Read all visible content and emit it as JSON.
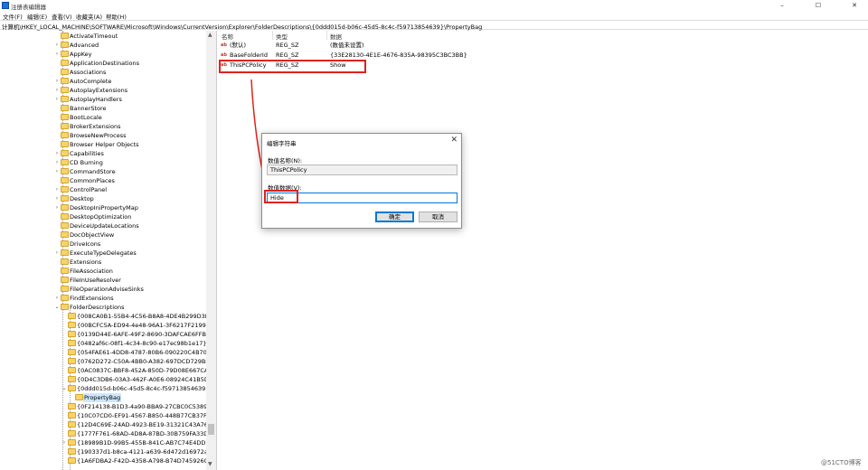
{
  "window": {
    "title": "注册表编辑器",
    "min": "–",
    "max": "☐",
    "close": "✕"
  },
  "menu": [
    "文件(F)",
    "编辑(E)",
    "查看(V)",
    "收藏夹(A)",
    "帮助(H)"
  ],
  "address": "计算机\\HKEY_LOCAL_MACHINE\\SOFTWARE\\Microsoft\\Windows\\CurrentVersion\\Explorer\\FolderDescriptions\\{0ddd015d-b06c-45d5-8c4c-f59713854639}\\PropertyBag",
  "tree": [
    {
      "label": "ActivateTimeout",
      "exp": ""
    },
    {
      "label": "Advanced",
      "exp": "›"
    },
    {
      "label": "AppKey",
      "exp": "›"
    },
    {
      "label": "ApplicationDestinations",
      "exp": ""
    },
    {
      "label": "Associations",
      "exp": ""
    },
    {
      "label": "AutoComplete",
      "exp": "›"
    },
    {
      "label": "AutoplayExtensions",
      "exp": "›"
    },
    {
      "label": "AutoplayHandlers",
      "exp": "›"
    },
    {
      "label": "BannerStore",
      "exp": ""
    },
    {
      "label": "BootLocale",
      "exp": ""
    },
    {
      "label": "BrokerExtensions",
      "exp": ""
    },
    {
      "label": "BrowseNewProcess",
      "exp": ""
    },
    {
      "label": "Browser Helper Objects",
      "exp": ""
    },
    {
      "label": "Capabilities",
      "exp": "›"
    },
    {
      "label": "CD Burning",
      "exp": "›"
    },
    {
      "label": "CommandStore",
      "exp": "›"
    },
    {
      "label": "CommonPlaces",
      "exp": ""
    },
    {
      "label": "ControlPanel",
      "exp": "›"
    },
    {
      "label": "Desktop",
      "exp": "›"
    },
    {
      "label": "DesktopIniPropertyMap",
      "exp": "›"
    },
    {
      "label": "DesktopOptimization",
      "exp": ""
    },
    {
      "label": "DeviceUpdateLocations",
      "exp": ""
    },
    {
      "label": "DocObjectView",
      "exp": ""
    },
    {
      "label": "DriveIcons",
      "exp": ""
    },
    {
      "label": "ExecuteTypeDelegates",
      "exp": "›"
    },
    {
      "label": "Extensions",
      "exp": ""
    },
    {
      "label": "FileAssociation",
      "exp": ""
    },
    {
      "label": "FileInUseResolver",
      "exp": ""
    },
    {
      "label": "FileOperationAdviseSinks",
      "exp": ""
    },
    {
      "label": "FindExtensions",
      "exp": "›"
    },
    {
      "label": "FolderDescriptions",
      "exp": "⌄"
    }
  ],
  "subtree": [
    {
      "label": "{008CA0B1-55B4-4C56-B8A8-4DE4B299D3BE}",
      "exp": ""
    },
    {
      "label": "{00BCFC5A-ED94-4e48-96A1-3F6217F21990}",
      "exp": ""
    },
    {
      "label": "{0139D44E-6AFE-49F2-8690-3DAFCAE6FFB8}",
      "exp": ""
    },
    {
      "label": "{0482af6c-08f1-4c34-8c90-e17ec98b1e17}",
      "exp": ""
    },
    {
      "label": "{054FAE61-4DD8-4787-80B6-090220C4B700}",
      "exp": ""
    },
    {
      "label": "{0762D272-C50A-4BB0-A382-697DCD729B80}",
      "exp": ""
    },
    {
      "label": "{0AC0837C-BBF8-452A-850D-79D08E667CA7}",
      "exp": ""
    },
    {
      "label": "{0D4C3DB6-03A3-462F-A0E6-08924C41B5D4}",
      "exp": ""
    },
    {
      "label": "{0ddd015d-b06c-45d5-8c4c-f59713854639}",
      "exp": "⌄"
    }
  ],
  "selected_child": {
    "label": "PropertyBag"
  },
  "subtree_after": [
    {
      "label": "{0F214138-B1D3-4a90-BBA9-27CBC0C5389A}",
      "exp": ""
    },
    {
      "label": "{10C07CD0-EF91-4567-B850-448B77CB37F9}",
      "exp": ""
    },
    {
      "label": "{12D4C69E-24AD-4923-BE19-31321C43A767}",
      "exp": ""
    },
    {
      "label": "{1777F761-68AD-4D8A-87BD-30B759FA33DD}",
      "exp": ""
    },
    {
      "label": "{18989B1D-99B5-455B-841C-AB7C74E4DDFC}",
      "exp": "›"
    },
    {
      "label": "{190337d1-b8ca-4121-a639-6d472d16972a}",
      "exp": ""
    },
    {
      "label": "{1A6FDBA2-F42D-4358-A798-B74D745926C5}",
      "exp": ""
    }
  ],
  "columns": {
    "name": "名称",
    "type": "类型",
    "data": "数据"
  },
  "values": [
    {
      "name": "(默认)",
      "type": "REG_SZ",
      "data": "(数值未设置)"
    },
    {
      "name": "BaseFolderId",
      "type": "REG_SZ",
      "data": "{33E28130-4E1E-4676-835A-98395C3BC3BB}"
    },
    {
      "name": "ThisPCPolicy",
      "type": "REG_SZ",
      "data": "Show"
    }
  ],
  "dialog": {
    "title": "编辑字符串",
    "close": "✕",
    "name_label": "数值名称(N):",
    "name_value": "ThisPCPolicy",
    "data_label": "数值数据(V):",
    "data_value": "Hide",
    "ok": "确定",
    "cancel": "取消"
  },
  "watermark": "@51CTO博客",
  "colors": {
    "annotation": "#e0221b",
    "selection": "#cce8ff",
    "folder": "#f7d36a"
  }
}
